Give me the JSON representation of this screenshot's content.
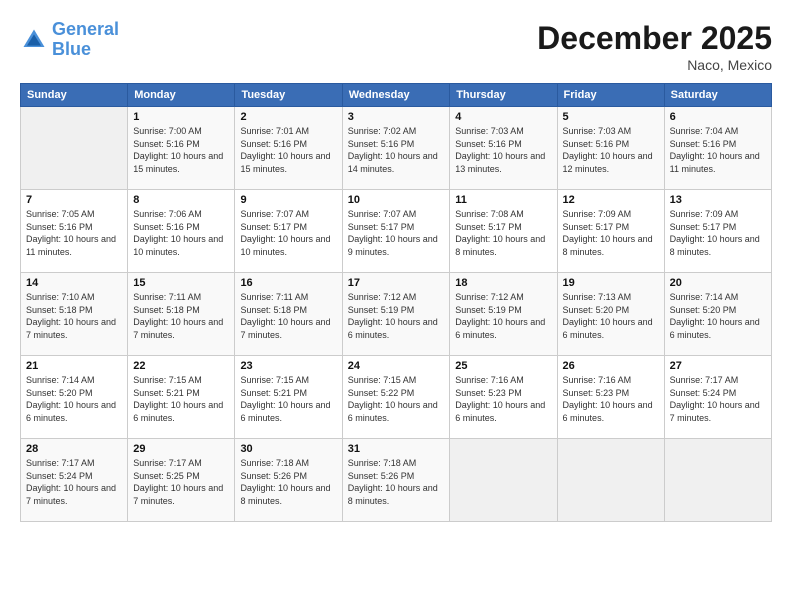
{
  "logo": {
    "line1": "General",
    "line2": "Blue"
  },
  "title": "December 2025",
  "location": "Naco, Mexico",
  "days_of_week": [
    "Sunday",
    "Monday",
    "Tuesday",
    "Wednesday",
    "Thursday",
    "Friday",
    "Saturday"
  ],
  "weeks": [
    [
      {
        "num": "",
        "info": ""
      },
      {
        "num": "1",
        "info": "Sunrise: 7:00 AM\nSunset: 5:16 PM\nDaylight: 10 hours\nand 15 minutes."
      },
      {
        "num": "2",
        "info": "Sunrise: 7:01 AM\nSunset: 5:16 PM\nDaylight: 10 hours\nand 15 minutes."
      },
      {
        "num": "3",
        "info": "Sunrise: 7:02 AM\nSunset: 5:16 PM\nDaylight: 10 hours\nand 14 minutes."
      },
      {
        "num": "4",
        "info": "Sunrise: 7:03 AM\nSunset: 5:16 PM\nDaylight: 10 hours\nand 13 minutes."
      },
      {
        "num": "5",
        "info": "Sunrise: 7:03 AM\nSunset: 5:16 PM\nDaylight: 10 hours\nand 12 minutes."
      },
      {
        "num": "6",
        "info": "Sunrise: 7:04 AM\nSunset: 5:16 PM\nDaylight: 10 hours\nand 11 minutes."
      }
    ],
    [
      {
        "num": "7",
        "info": "Sunrise: 7:05 AM\nSunset: 5:16 PM\nDaylight: 10 hours\nand 11 minutes."
      },
      {
        "num": "8",
        "info": "Sunrise: 7:06 AM\nSunset: 5:16 PM\nDaylight: 10 hours\nand 10 minutes."
      },
      {
        "num": "9",
        "info": "Sunrise: 7:07 AM\nSunset: 5:17 PM\nDaylight: 10 hours\nand 10 minutes."
      },
      {
        "num": "10",
        "info": "Sunrise: 7:07 AM\nSunset: 5:17 PM\nDaylight: 10 hours\nand 9 minutes."
      },
      {
        "num": "11",
        "info": "Sunrise: 7:08 AM\nSunset: 5:17 PM\nDaylight: 10 hours\nand 8 minutes."
      },
      {
        "num": "12",
        "info": "Sunrise: 7:09 AM\nSunset: 5:17 PM\nDaylight: 10 hours\nand 8 minutes."
      },
      {
        "num": "13",
        "info": "Sunrise: 7:09 AM\nSunset: 5:17 PM\nDaylight: 10 hours\nand 8 minutes."
      }
    ],
    [
      {
        "num": "14",
        "info": "Sunrise: 7:10 AM\nSunset: 5:18 PM\nDaylight: 10 hours\nand 7 minutes."
      },
      {
        "num": "15",
        "info": "Sunrise: 7:11 AM\nSunset: 5:18 PM\nDaylight: 10 hours\nand 7 minutes."
      },
      {
        "num": "16",
        "info": "Sunrise: 7:11 AM\nSunset: 5:18 PM\nDaylight: 10 hours\nand 7 minutes."
      },
      {
        "num": "17",
        "info": "Sunrise: 7:12 AM\nSunset: 5:19 PM\nDaylight: 10 hours\nand 6 minutes."
      },
      {
        "num": "18",
        "info": "Sunrise: 7:12 AM\nSunset: 5:19 PM\nDaylight: 10 hours\nand 6 minutes."
      },
      {
        "num": "19",
        "info": "Sunrise: 7:13 AM\nSunset: 5:20 PM\nDaylight: 10 hours\nand 6 minutes."
      },
      {
        "num": "20",
        "info": "Sunrise: 7:14 AM\nSunset: 5:20 PM\nDaylight: 10 hours\nand 6 minutes."
      }
    ],
    [
      {
        "num": "21",
        "info": "Sunrise: 7:14 AM\nSunset: 5:20 PM\nDaylight: 10 hours\nand 6 minutes."
      },
      {
        "num": "22",
        "info": "Sunrise: 7:15 AM\nSunset: 5:21 PM\nDaylight: 10 hours\nand 6 minutes."
      },
      {
        "num": "23",
        "info": "Sunrise: 7:15 AM\nSunset: 5:21 PM\nDaylight: 10 hours\nand 6 minutes."
      },
      {
        "num": "24",
        "info": "Sunrise: 7:15 AM\nSunset: 5:22 PM\nDaylight: 10 hours\nand 6 minutes."
      },
      {
        "num": "25",
        "info": "Sunrise: 7:16 AM\nSunset: 5:23 PM\nDaylight: 10 hours\nand 6 minutes."
      },
      {
        "num": "26",
        "info": "Sunrise: 7:16 AM\nSunset: 5:23 PM\nDaylight: 10 hours\nand 6 minutes."
      },
      {
        "num": "27",
        "info": "Sunrise: 7:17 AM\nSunset: 5:24 PM\nDaylight: 10 hours\nand 7 minutes."
      }
    ],
    [
      {
        "num": "28",
        "info": "Sunrise: 7:17 AM\nSunset: 5:24 PM\nDaylight: 10 hours\nand 7 minutes."
      },
      {
        "num": "29",
        "info": "Sunrise: 7:17 AM\nSunset: 5:25 PM\nDaylight: 10 hours\nand 7 minutes."
      },
      {
        "num": "30",
        "info": "Sunrise: 7:18 AM\nSunset: 5:26 PM\nDaylight: 10 hours\nand 8 minutes."
      },
      {
        "num": "31",
        "info": "Sunrise: 7:18 AM\nSunset: 5:26 PM\nDaylight: 10 hours\nand 8 minutes."
      },
      {
        "num": "",
        "info": ""
      },
      {
        "num": "",
        "info": ""
      },
      {
        "num": "",
        "info": ""
      }
    ]
  ]
}
